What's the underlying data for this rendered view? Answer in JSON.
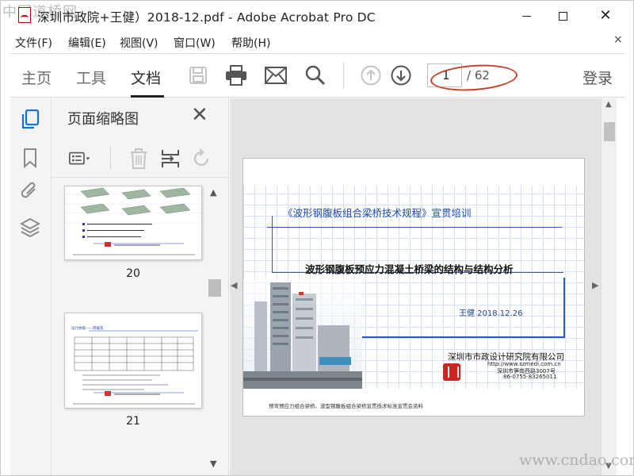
{
  "window": {
    "title": "深圳市政院+王健）2018-12.pdf - Adobe Acrobat Pro DC",
    "watermark_top": "中国道桥网",
    "watermark_bottom": "www.cndao.com"
  },
  "menu": {
    "items": [
      "文件(F)",
      "编辑(E)",
      "视图(V)",
      "窗口(W)",
      "帮助(H)"
    ],
    "close_symbol": "×"
  },
  "toolbar": {
    "tabs": [
      "主页",
      "工具",
      "文档"
    ],
    "active_tab": "文档",
    "icons": [
      "save-icon",
      "print-icon",
      "mail-icon",
      "search-icon",
      "page-up-icon",
      "page-down-icon"
    ],
    "current_page": "1",
    "page_total": "/ 62",
    "login": "登录",
    "highlight_color": "#c8402a"
  },
  "rail": {
    "icons": [
      "page-thumbnails-icon",
      "bookmark-icon",
      "attachment-icon",
      "layers-icon"
    ],
    "accent": "#1a6fd1"
  },
  "thumb_panel": {
    "title": "页面缩略图",
    "close_symbol": "✕",
    "tools": [
      "options-menu-icon",
      "delete-icon",
      "insert-icon",
      "rotate-icon"
    ],
    "thumbnails": [
      {
        "label": "20"
      },
      {
        "label": "21",
        "title": "设计依据——荷载及"
      }
    ]
  },
  "document": {
    "slide_title": "《波形钢腹板组合梁桥技术规程》宣贯培训",
    "slide_subtitle": "波形钢腹板预应力混凝土桥梁的结构与结构分析",
    "author_date": "王健  2018.12.26",
    "organization": "深圳市市政设计研究院有限公司",
    "website": "http://www.szmedi.com.cn",
    "address": "深圳市笋岗西路3007号",
    "phone": "86-0755-83265011",
    "footer": "预弯预应力组合梁桥、波型钢腹板组合梁桥宣贯技术标准宣贯会资料",
    "accent_blue": "#2e57c8",
    "logo_red": "#d0231f"
  }
}
